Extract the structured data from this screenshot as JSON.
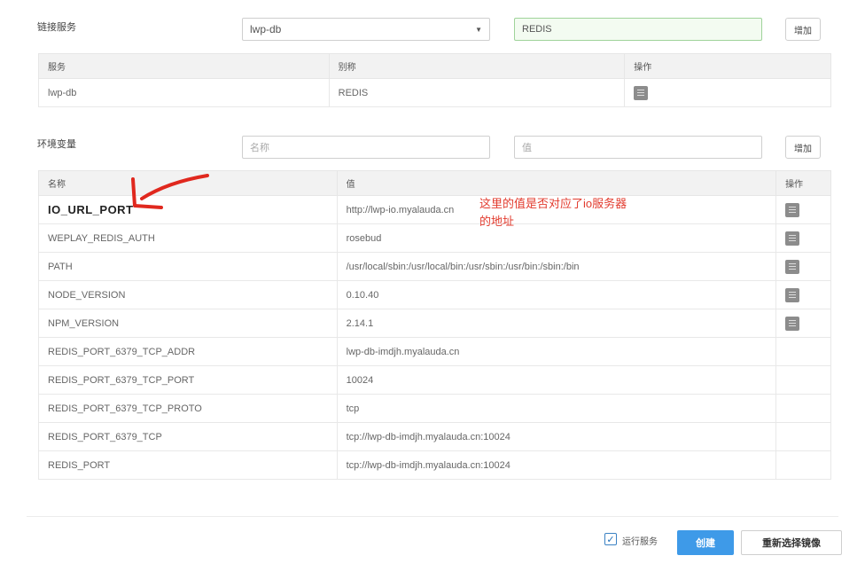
{
  "linked_services": {
    "label": "链接服务",
    "service_select": "lwp-db",
    "alias_value": "REDIS",
    "add_label": "增加",
    "headers": [
      "服务",
      "别称",
      "操作"
    ],
    "rows": [
      {
        "service": "lwp-db",
        "alias": "REDIS"
      }
    ]
  },
  "env_vars": {
    "label": "环境变量",
    "name_placeholder": "名称",
    "value_placeholder": "值",
    "add_label": "增加",
    "headers": [
      "名称",
      "值",
      "操作"
    ],
    "rows": [
      {
        "name": "IO_URL_PORT",
        "value": "http://lwp-io.myalauda.cn",
        "deletable": true
      },
      {
        "name": "WEPLAY_REDIS_AUTH",
        "value": "rosebud",
        "deletable": true
      },
      {
        "name": "PATH",
        "value": "/usr/local/sbin:/usr/local/bin:/usr/sbin:/usr/bin:/sbin:/bin",
        "deletable": true
      },
      {
        "name": "NODE_VERSION",
        "value": "0.10.40",
        "deletable": true
      },
      {
        "name": "NPM_VERSION",
        "value": "2.14.1",
        "deletable": true
      },
      {
        "name": "REDIS_PORT_6379_TCP_ADDR",
        "value": "lwp-db-imdjh.myalauda.cn",
        "deletable": false
      },
      {
        "name": "REDIS_PORT_6379_TCP_PORT",
        "value": "10024",
        "deletable": false
      },
      {
        "name": "REDIS_PORT_6379_TCP_PROTO",
        "value": "tcp",
        "deletable": false
      },
      {
        "name": "REDIS_PORT_6379_TCP",
        "value": "tcp://lwp-db-imdjh.myalauda.cn:10024",
        "deletable": false
      },
      {
        "name": "REDIS_PORT",
        "value": "tcp://lwp-db-imdjh.myalauda.cn:10024",
        "deletable": false
      }
    ]
  },
  "annotation": {
    "line1": "这里的值是否对应了io服务器",
    "line2": "的地址",
    "color": "#e23b2e"
  },
  "footer": {
    "run_service_label": "运行服务",
    "run_service_checked": true,
    "create_label": "创建",
    "reselect_label": "重新选择镜像"
  },
  "colors": {
    "primary": "#3e9ae8",
    "focus_green": "#9fd39a",
    "trash_gray": "#8c8c8c"
  },
  "icons": {
    "delete": "trash-icon",
    "dropdown": "chevron-down-icon",
    "check": "checkmark-icon",
    "annotation_arrow": "red-arrow-icon"
  }
}
